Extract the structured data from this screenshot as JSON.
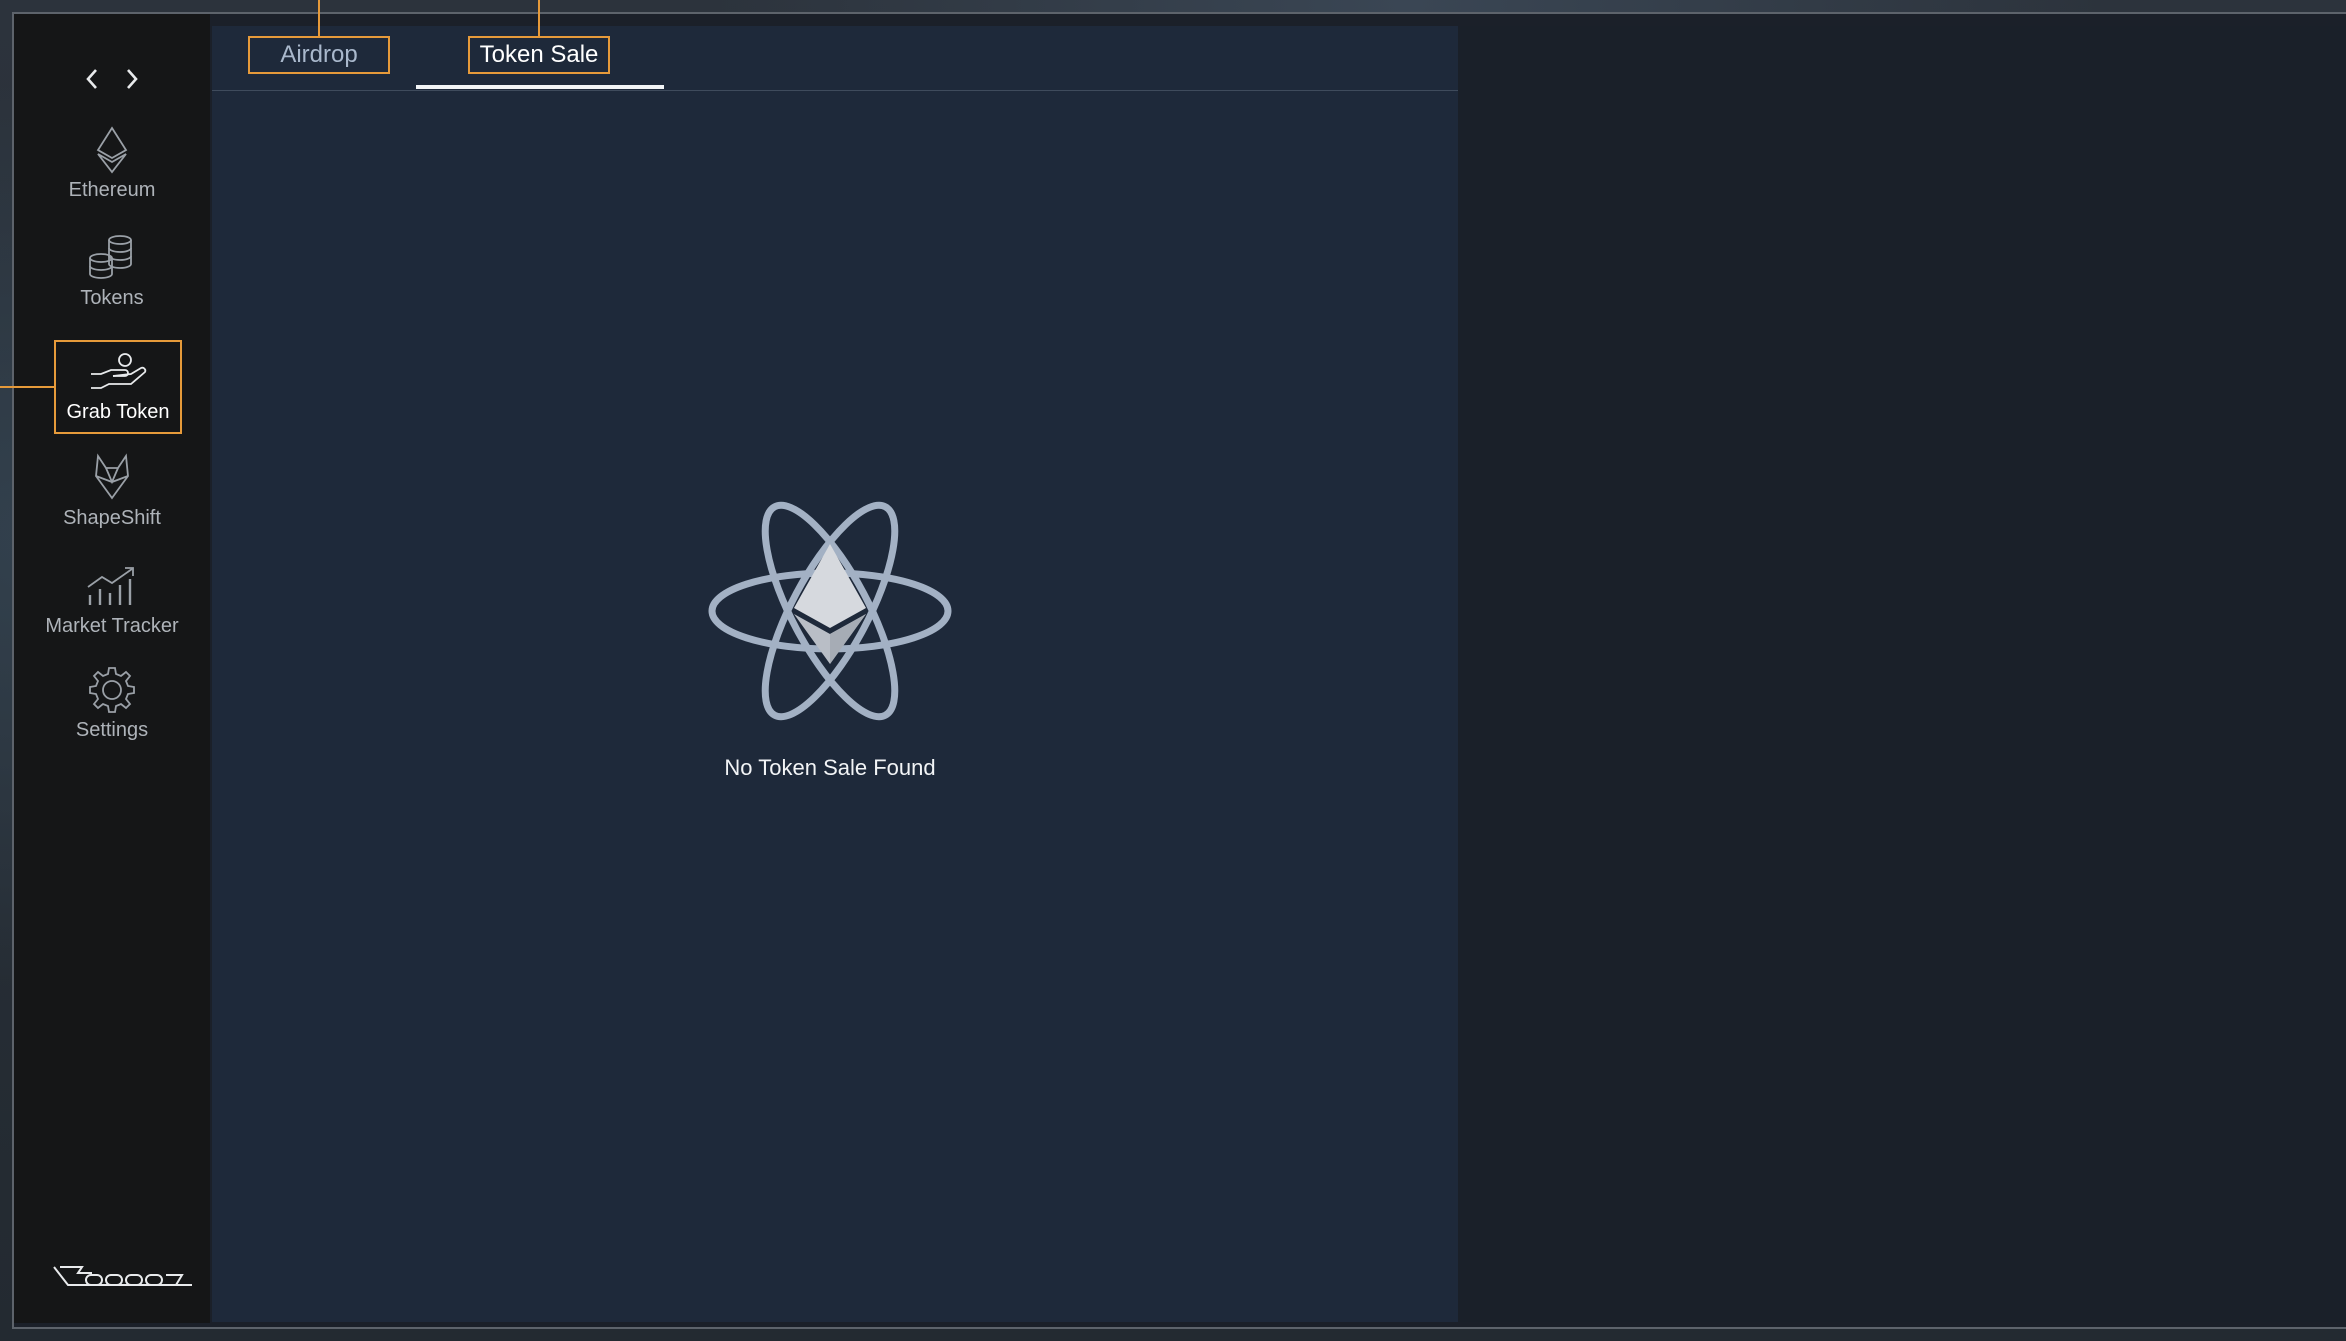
{
  "sidebar": {
    "nav": {
      "back_icon": "chevron-left-icon",
      "forward_icon": "chevron-right-icon"
    },
    "items": [
      {
        "label": "Ethereum",
        "icon": "ethereum-icon"
      },
      {
        "label": "Tokens",
        "icon": "coins-icon"
      },
      {
        "label": "Grab Token",
        "icon": "hand-coin-icon",
        "active": true
      },
      {
        "label": "ShapeShift",
        "icon": "fox-icon"
      },
      {
        "label": "Market Tracker",
        "icon": "chart-growth-icon"
      },
      {
        "label": "Settings",
        "icon": "gear-icon"
      }
    ],
    "logo": "brand-logo"
  },
  "tabs": [
    {
      "label": "Airdrop",
      "active": false
    },
    {
      "label": "Token Sale",
      "active": true
    }
  ],
  "empty_state": {
    "icon": "ethereum-atom-icon",
    "message": "No Token Sale Found"
  },
  "colors": {
    "accent": "#e69a3a",
    "sidebar_bg": "#151617",
    "main_bg": "#1e293a",
    "text_primary": "#ffffff",
    "text_muted": "#aeb3b9"
  }
}
